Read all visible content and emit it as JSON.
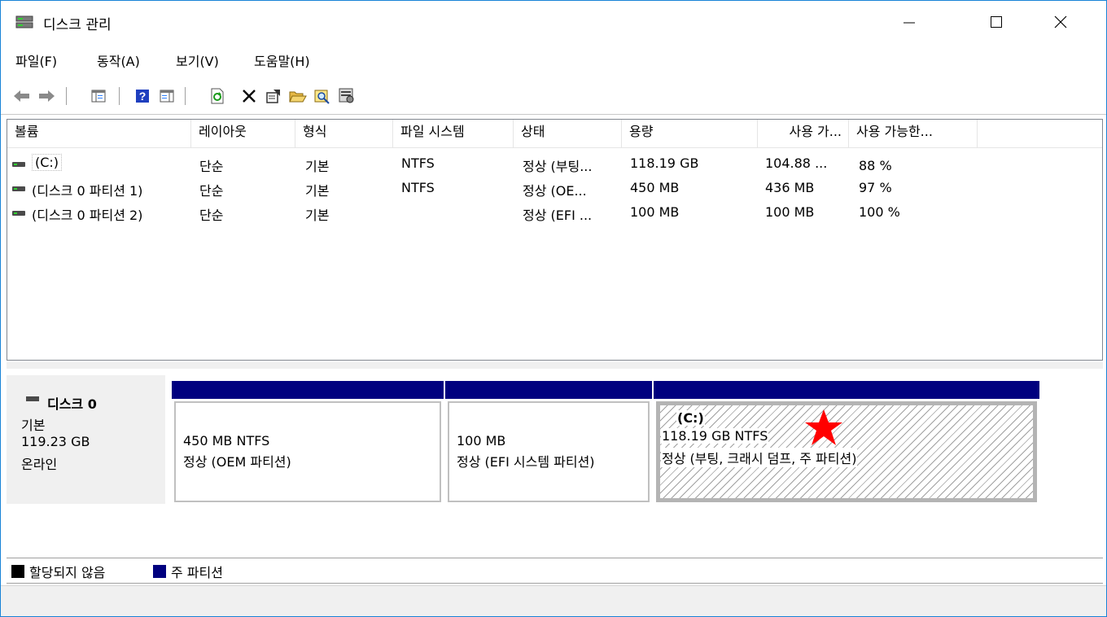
{
  "window": {
    "title": "디스크 관리",
    "controls": {
      "minimize": "—",
      "maximize": "☐",
      "close": "✕"
    }
  },
  "menu": [
    {
      "label": "파일(F)"
    },
    {
      "label": "동작(A)"
    },
    {
      "label": "보기(V)"
    },
    {
      "label": "도움말(H)"
    }
  ],
  "toolbar": {
    "buttons": [
      "back-icon",
      "forward-icon",
      "show-hide-console-tree-icon",
      "help-icon",
      "show-hide-action-pane-icon",
      "refresh-icon",
      "delete-icon",
      "properties-icon",
      "open-icon",
      "explore-icon",
      "settings-icon"
    ]
  },
  "volume_list": {
    "columns": [
      "볼륨",
      "레이아웃",
      "형식",
      "파일 시스템",
      "상태",
      "용량",
      "사용 가...",
      "사용 가능한..."
    ],
    "rows": [
      {
        "volume": "(C:)",
        "layout": "단순",
        "type": "기본",
        "fs": "NTFS",
        "status": "정상 (부팅...",
        "capacity": "118.19 GB",
        "free": "104.88 ...",
        "pct_free": "88 %"
      },
      {
        "volume": "(디스크 0 파티션 1)",
        "layout": "단순",
        "type": "기본",
        "fs": "NTFS",
        "status": "정상 (OE...",
        "capacity": "450 MB",
        "free": "436 MB",
        "pct_free": "97 %"
      },
      {
        "volume": "(디스크 0 파티션 2)",
        "layout": "단순",
        "type": "기본",
        "fs": "",
        "status": "정상 (EFI ...",
        "capacity": "100 MB",
        "free": "100 MB",
        "pct_free": "100 %"
      }
    ]
  },
  "disk": {
    "name": "디스크 0",
    "type": "기본",
    "size": "119.23 GB",
    "status": "온라인",
    "partitions": [
      {
        "label": "",
        "line1": "450 MB NTFS",
        "line2": "정상 (OEM 파티션)"
      },
      {
        "label": "",
        "line1": "100 MB",
        "line2": "정상 (EFI 시스템 파티션)"
      },
      {
        "label": "(C:)",
        "line1": "118.19 GB NTFS",
        "line2": "정상 (부팅, 크래시 덤프, 주 파티션)"
      }
    ]
  },
  "legend": {
    "unallocated": "할당되지 않음",
    "primary": "주 파티션",
    "unallocated_color": "#000000",
    "primary_color": "#00007f"
  },
  "colors": {
    "partition_header": "#00007f",
    "annotation_star": "#ff0000"
  }
}
